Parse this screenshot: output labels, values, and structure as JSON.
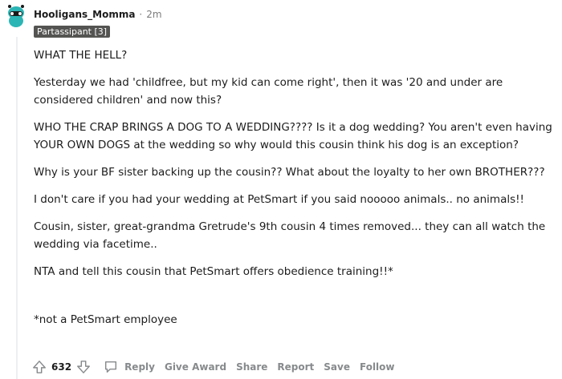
{
  "comment": {
    "username": "Hooligans_Momma",
    "separator": "·",
    "timestamp": "2m",
    "flair": "Partassipant [3]",
    "paragraphs": [
      "WHAT THE HELL?",
      "Yesterday we had 'childfree, but my kid can come right', then it was '20 and under are considered children' and now this?",
      "WHO THE CRAP BRINGS A DOG TO A WEDDING???? Is it a dog wedding? You aren't even having YOUR OWN DOGS at the wedding so why would this cousin think his dog is an exception?",
      "Why is your BF sister backing up the cousin?? What about the loyalty to her own BROTHER???",
      "I don't care if you had your wedding at PetSmart if you said nooooo animals.. no animals!!",
      "Cousin, sister, great-grandma Gretrude's 9th cousin 4 times removed... they can all watch the wedding via facetime..",
      "NTA and tell this cousin that PetSmart offers obedience training!!*"
    ],
    "footnote": "*not a PetSmart employee"
  },
  "actions": {
    "vote_count": "632",
    "reply": "Reply",
    "give_award": "Give Award",
    "share": "Share",
    "report": "Report",
    "save": "Save",
    "follow": "Follow"
  },
  "icons": {
    "upvote": "upvote-arrow-icon",
    "downvote": "downvote-arrow-icon",
    "reply": "speech-bubble-icon"
  },
  "colors": {
    "flair_bg": "#545452",
    "action_text": "#878a8c",
    "avatar_bg": "#2cb5b5"
  }
}
